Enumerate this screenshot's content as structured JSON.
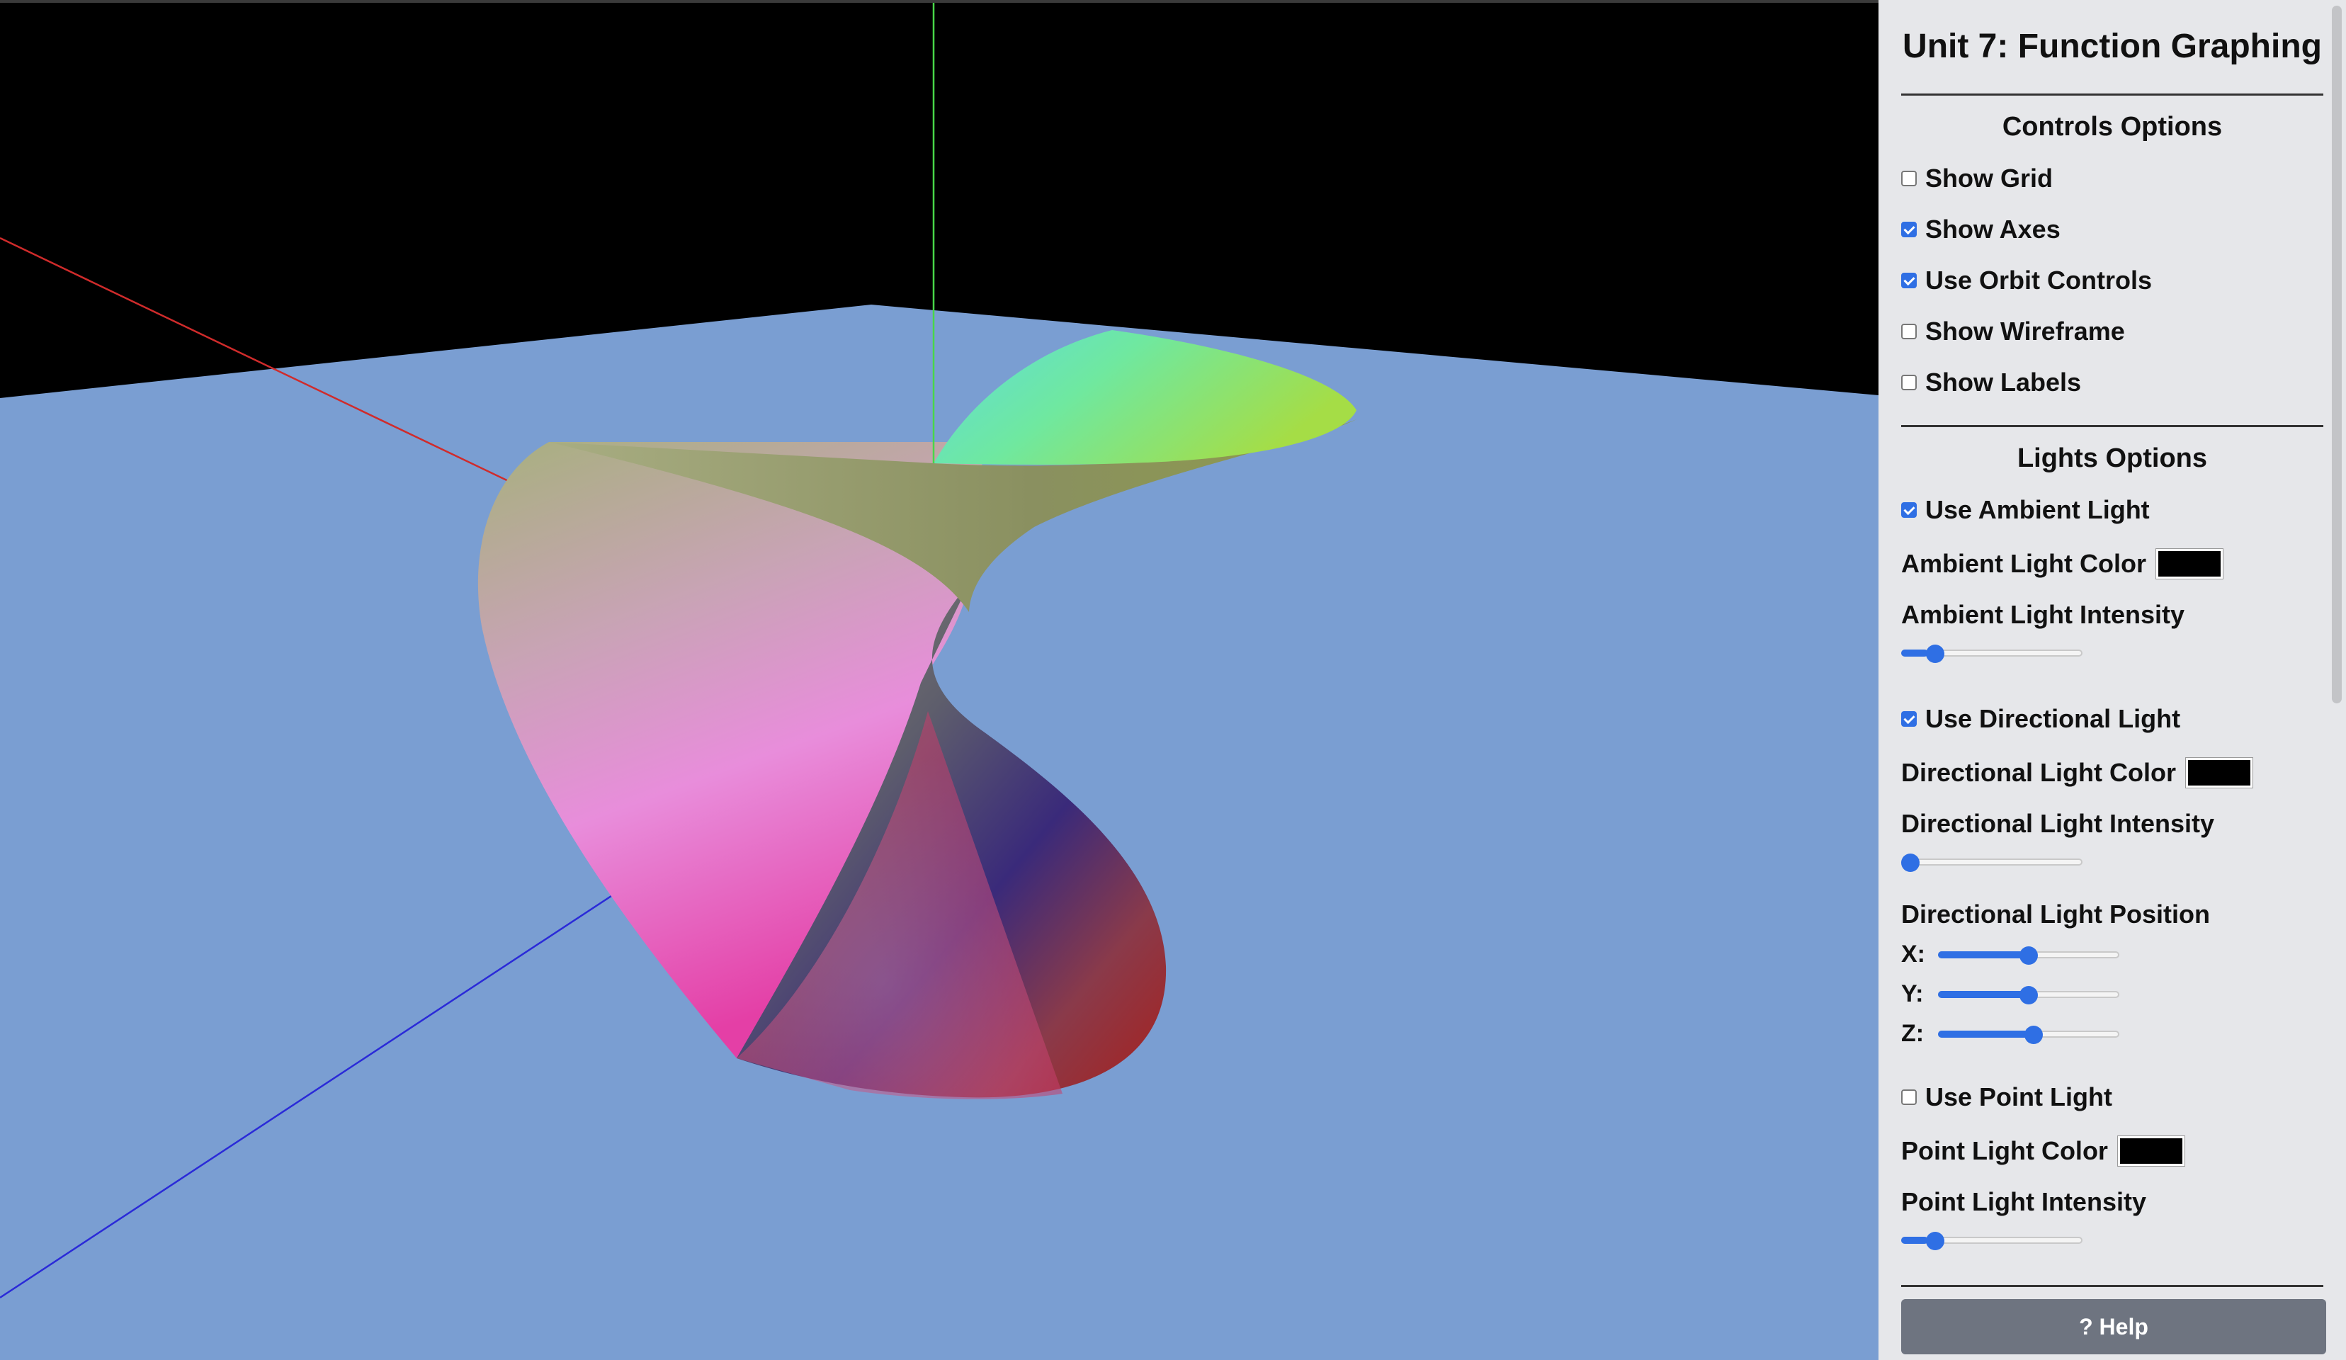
{
  "app": {
    "title": "Unit 7: Function Graphing"
  },
  "colors": {
    "background": "#000000",
    "ground_plane": "#7a9ed2",
    "x_axis": "#d02b2b",
    "y_axis": "#49d649",
    "z_axis": "#2a2ad8",
    "accent": "#2f6fe4",
    "panel_bg": "#e6e7ea",
    "help_button": "#6e7480"
  },
  "controls": {
    "title": "Controls Options",
    "show_grid": {
      "label": "Show Grid",
      "checked": false
    },
    "show_axes": {
      "label": "Show Axes",
      "checked": true
    },
    "use_orbit": {
      "label": "Use Orbit Controls",
      "checked": true
    },
    "show_wireframe": {
      "label": "Show Wireframe",
      "checked": false
    },
    "show_labels": {
      "label": "Show Labels",
      "checked": false
    }
  },
  "lights": {
    "title": "Lights Options",
    "use_ambient": {
      "label": "Use Ambient Light",
      "checked": true
    },
    "ambient_color": {
      "label": "Ambient Light Color",
      "value": "#000000"
    },
    "ambient_intensity": {
      "label": "Ambient Light Intensity",
      "value": 0.15
    },
    "use_directional": {
      "label": "Use Directional Light",
      "checked": true
    },
    "directional_color": {
      "label": "Directional Light Color",
      "value": "#000000"
    },
    "directional_intensity": {
      "label": "Directional Light Intensity",
      "value": 0.0
    },
    "directional_position": {
      "label": "Directional Light Position",
      "x": {
        "label": "X:",
        "value": 0.5
      },
      "y": {
        "label": "Y:",
        "value": 0.5
      },
      "z": {
        "label": "Z:",
        "value": 0.53
      }
    },
    "use_point": {
      "label": "Use Point Light",
      "checked": false
    },
    "point_color": {
      "label": "Point Light Color",
      "value": "#000000"
    },
    "point_intensity": {
      "label": "Point Light Intensity",
      "value": 0.15
    }
  },
  "help": {
    "label": "? Help"
  }
}
